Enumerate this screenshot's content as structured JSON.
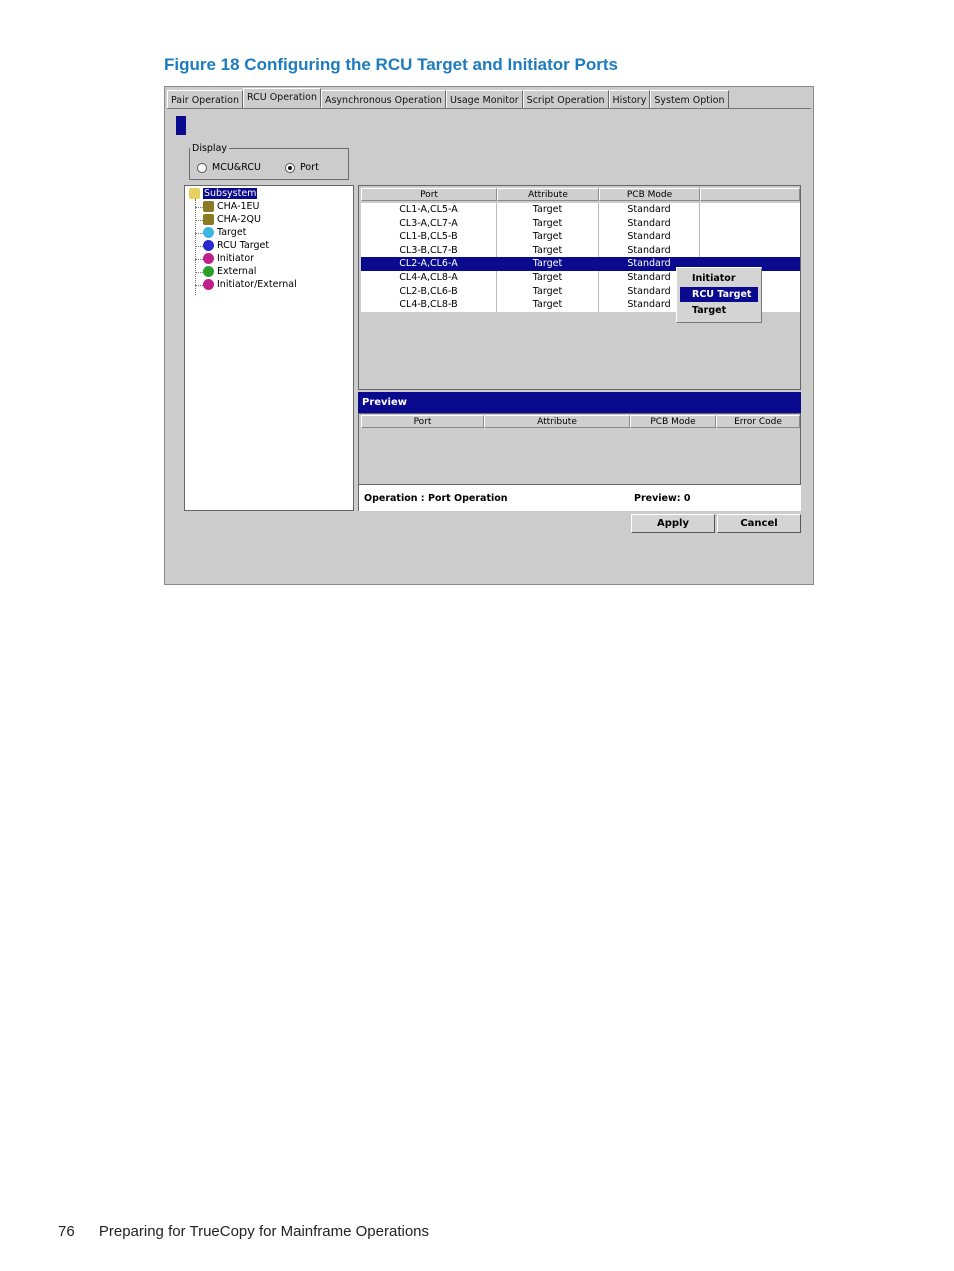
{
  "caption": "Figure 18 Configuring the RCU Target and Initiator Ports",
  "footer": {
    "page_number": "76",
    "text": "Preparing for TrueCopy for Mainframe Operations"
  },
  "tabs": [
    {
      "label": "Pair Operation",
      "active": false
    },
    {
      "label": "RCU Operation",
      "active": true
    },
    {
      "label": "Asynchronous Operation",
      "active": false
    },
    {
      "label": "Usage Monitor",
      "active": false
    },
    {
      "label": "Script Operation",
      "active": false
    },
    {
      "label": "History",
      "active": false
    },
    {
      "label": "System Option",
      "active": false
    }
  ],
  "display": {
    "legend": "Display",
    "options": [
      {
        "label": "MCU&RCU",
        "selected": false
      },
      {
        "label": "Port",
        "selected": true
      }
    ]
  },
  "tree": {
    "root": {
      "label": "Subsystem",
      "icon": "folder-icon"
    },
    "items": [
      {
        "label": "CHA-1EU",
        "icon": "cha-icon",
        "color": "#8a7a20"
      },
      {
        "label": "CHA-2QU",
        "icon": "cha-icon",
        "color": "#8a7a20"
      },
      {
        "label": "Target",
        "icon": "target-port-icon",
        "color": "#3bb6e0"
      },
      {
        "label": "RCU Target",
        "icon": "rcu-target-port-icon",
        "color": "#2a2ad0"
      },
      {
        "label": "Initiator",
        "icon": "initiator-port-icon",
        "color": "#c0208a"
      },
      {
        "label": "External",
        "icon": "external-port-icon",
        "color": "#2aa02a"
      },
      {
        "label": "Initiator/External",
        "icon": "initiator-external-port-icon",
        "color": "#c0208a"
      }
    ]
  },
  "port_table": {
    "columns": [
      "Port",
      "Attribute",
      "PCB Mode",
      ""
    ],
    "rows": [
      {
        "port": "CL1-A,CL5-A",
        "attribute": "Target",
        "pcb_mode": "Standard",
        "selected": false
      },
      {
        "port": "CL3-A,CL7-A",
        "attribute": "Target",
        "pcb_mode": "Standard",
        "selected": false
      },
      {
        "port": "CL1-B,CL5-B",
        "attribute": "Target",
        "pcb_mode": "Standard",
        "selected": false
      },
      {
        "port": "CL3-B,CL7-B",
        "attribute": "Target",
        "pcb_mode": "Standard",
        "selected": false
      },
      {
        "port": "CL2-A,CL6-A",
        "attribute": "Target",
        "pcb_mode": "Standard",
        "selected": true
      },
      {
        "port": "CL4-A,CL8-A",
        "attribute": "Target",
        "pcb_mode": "Standard",
        "selected": false
      },
      {
        "port": "CL2-B,CL6-B",
        "attribute": "Target",
        "pcb_mode": "Standard",
        "selected": false
      },
      {
        "port": "CL4-B,CL8-B",
        "attribute": "Target",
        "pcb_mode": "Standard",
        "selected": false
      }
    ]
  },
  "context_menu": {
    "items": [
      {
        "label": "Initiator",
        "highlighted": false
      },
      {
        "label": "RCU Target",
        "highlighted": true
      },
      {
        "label": "Target",
        "highlighted": false
      }
    ]
  },
  "preview": {
    "title": "Preview",
    "columns": [
      "Port",
      "Attribute",
      "PCB Mode",
      "Error Code"
    ],
    "operation_label": "Operation :",
    "operation_value": "Port Operation",
    "preview_count": "Preview: 0"
  },
  "buttons": {
    "apply": "Apply",
    "cancel": "Cancel"
  },
  "colors": {
    "caption": "#1d7cc0",
    "selection": "#0a0a8f",
    "panel": "#cccccc"
  }
}
